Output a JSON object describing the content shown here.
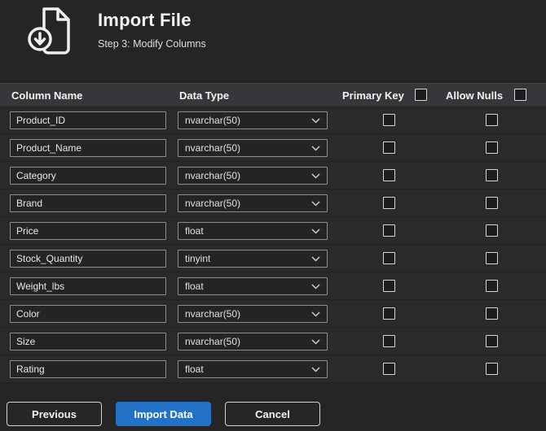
{
  "page": {
    "title": "Import File",
    "subtitle": "Step 3: Modify Columns"
  },
  "table": {
    "headers": {
      "column_name": "Column Name",
      "data_type": "Data Type",
      "primary_key": "Primary Key",
      "allow_nulls": "Allow Nulls"
    },
    "header_checkboxes": {
      "primary_key_checked": false,
      "allow_nulls_checked": false
    },
    "rows": [
      {
        "column_name": "Product_ID",
        "data_type": "nvarchar(50)",
        "primary_key": false,
        "allow_nulls": false
      },
      {
        "column_name": "Product_Name",
        "data_type": "nvarchar(50)",
        "primary_key": false,
        "allow_nulls": false
      },
      {
        "column_name": "Category",
        "data_type": "nvarchar(50)",
        "primary_key": false,
        "allow_nulls": false
      },
      {
        "column_name": "Brand",
        "data_type": "nvarchar(50)",
        "primary_key": false,
        "allow_nulls": false
      },
      {
        "column_name": "Price",
        "data_type": "float",
        "primary_key": false,
        "allow_nulls": false
      },
      {
        "column_name": "Stock_Quantity",
        "data_type": "tinyint",
        "primary_key": false,
        "allow_nulls": false
      },
      {
        "column_name": "Weight_lbs",
        "data_type": "float",
        "primary_key": false,
        "allow_nulls": false
      },
      {
        "column_name": "Color",
        "data_type": "nvarchar(50)",
        "primary_key": false,
        "allow_nulls": false
      },
      {
        "column_name": "Size",
        "data_type": "nvarchar(50)",
        "primary_key": false,
        "allow_nulls": false
      },
      {
        "column_name": "Rating",
        "data_type": "float",
        "primary_key": false,
        "allow_nulls": false
      }
    ]
  },
  "buttons": {
    "previous": "Previous",
    "import_data": "Import Data",
    "cancel": "Cancel"
  },
  "icons": {
    "header": "import-file-download-icon",
    "dropdown": "chevron-down-icon"
  },
  "colors": {
    "accent_blue": "#2472c8",
    "background": "#252526"
  }
}
